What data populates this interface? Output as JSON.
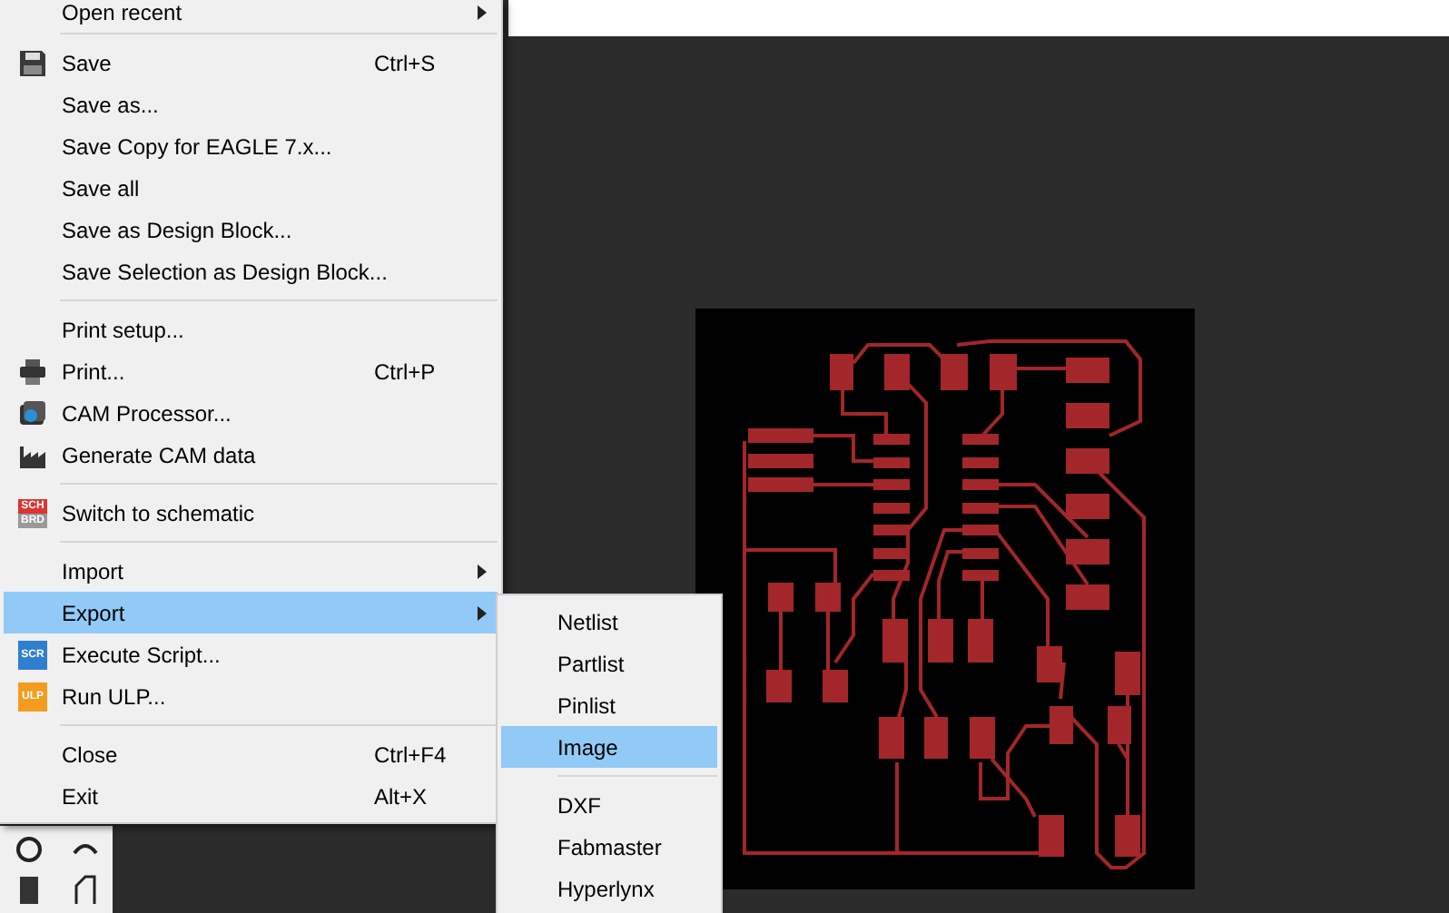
{
  "menu": {
    "groups": [
      [
        {
          "label": "Open recent",
          "submenu": true,
          "selected": false,
          "kind": "plain"
        }
      ],
      [
        {
          "label": "Save",
          "shortcut": "Ctrl+S",
          "submenu": false,
          "selected": false,
          "kind": "save"
        },
        {
          "label": "Save as...",
          "submenu": false,
          "selected": false,
          "kind": "plain"
        },
        {
          "label": "Save Copy for EAGLE 7.x...",
          "submenu": false,
          "selected": false,
          "kind": "plain"
        },
        {
          "label": "Save all",
          "submenu": false,
          "selected": false,
          "kind": "plain"
        },
        {
          "label": "Save as Design Block...",
          "submenu": false,
          "selected": false,
          "kind": "plain"
        },
        {
          "label": "Save Selection as Design Block...",
          "submenu": false,
          "selected": false,
          "kind": "plain"
        }
      ],
      [
        {
          "label": "Print setup...",
          "submenu": false,
          "selected": false,
          "kind": "plain"
        },
        {
          "label": "Print...",
          "shortcut": "Ctrl+P",
          "submenu": false,
          "selected": false,
          "kind": "print"
        },
        {
          "label": "CAM Processor...",
          "submenu": false,
          "selected": false,
          "kind": "camera"
        },
        {
          "label": "Generate CAM data",
          "submenu": false,
          "selected": false,
          "kind": "factory"
        }
      ],
      [
        {
          "label": "Switch to schematic",
          "submenu": false,
          "selected": false,
          "kind": "schematic",
          "icon_text": [
            "SCH",
            "BRD"
          ]
        }
      ],
      [
        {
          "label": "Import",
          "submenu": true,
          "selected": false,
          "kind": "plain"
        },
        {
          "label": "Export",
          "submenu": true,
          "selected": true,
          "kind": "plain"
        },
        {
          "label": "Execute Script...",
          "submenu": false,
          "selected": false,
          "kind": "script",
          "icon_text": [
            "SCR"
          ]
        },
        {
          "label": "Run ULP...",
          "submenu": false,
          "selected": false,
          "kind": "ulp",
          "icon_text": [
            "ULP"
          ]
        }
      ],
      [
        {
          "label": "Close",
          "shortcut": "Ctrl+F4",
          "submenu": false,
          "selected": false,
          "kind": "plain"
        },
        {
          "label": "Exit",
          "shortcut": "Alt+X",
          "submenu": false,
          "selected": false,
          "kind": "plain"
        }
      ]
    ]
  },
  "export_submenu": {
    "groups": [
      [
        {
          "label": "Netlist",
          "selected": false
        },
        {
          "label": "Partlist",
          "selected": false
        },
        {
          "label": "Pinlist",
          "selected": false
        },
        {
          "label": "Image",
          "selected": true
        }
      ],
      [
        {
          "label": "DXF",
          "selected": false
        },
        {
          "label": "Fabmaster",
          "selected": false
        },
        {
          "label": "Hyperlynx",
          "selected": false
        }
      ]
    ]
  }
}
